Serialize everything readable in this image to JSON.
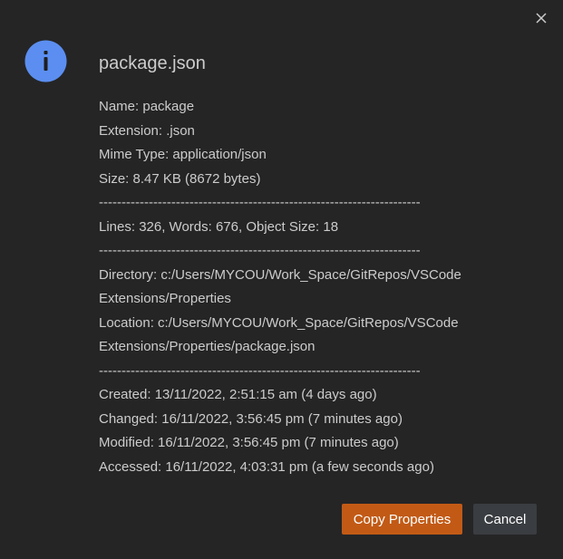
{
  "dialog": {
    "title": "package.json",
    "close_icon": "close-icon",
    "info_icon": "info-icon",
    "accent_color": "#5b8ef0",
    "details": {
      "name": "Name: package",
      "extension": "Extension: .json",
      "mime_type": "Mime Type: application/json",
      "size": "Size: 8.47 KB (8672 bytes)",
      "separator1": "-----------------------------------------------------------------------",
      "counts": "Lines: 326, Words: 676, Object Size: 18",
      "separator2": "-----------------------------------------------------------------------",
      "directory_line1": "Directory: c:/Users/MYCOU/Work_Space/GitRepos/VSCode",
      "directory_line2": "Extensions/Properties",
      "location_line1": "Location: c:/Users/MYCOU/Work_Space/GitRepos/VSCode",
      "location_line2": "Extensions/Properties/package.json",
      "separator3": "-----------------------------------------------------------------------",
      "created": "Created: 13/11/2022, 2:51:15 am (4 days ago)",
      "changed": "Changed: 16/11/2022, 3:56:45 pm (7 minutes ago)",
      "modified": "Modified: 16/11/2022, 3:56:45 pm (7 minutes ago)",
      "accessed": "Accessed: 16/11/2022, 4:03:31 pm (a few seconds ago)"
    },
    "buttons": {
      "copy_label": "Copy Properties",
      "copy_color": "#c25a16",
      "cancel_label": "Cancel",
      "cancel_color": "#3a3d41"
    }
  }
}
